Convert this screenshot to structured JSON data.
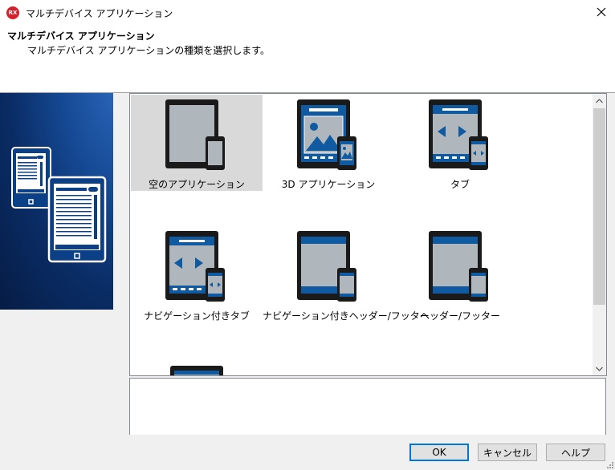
{
  "window": {
    "title": "マルチデバイス アプリケーション",
    "app_icon_text": "RX"
  },
  "header": {
    "title": "マルチデバイス アプリケーション",
    "description": "マルチデバイス アプリケーションの種類を選択します。"
  },
  "gallery": {
    "items": [
      {
        "label": "空のアプリケーション",
        "icon": "blank-app-icon",
        "selected": true
      },
      {
        "label": "3D アプリケーション",
        "icon": "3d-app-icon"
      },
      {
        "label": "タブ",
        "icon": "tab-app-icon"
      },
      {
        "label": "ナビゲーション付きタブ",
        "icon": "tab-navigation-app-icon"
      },
      {
        "label": "ナビゲーション付きヘッダー/フッター",
        "icon": "header-footer-navigation-app-icon"
      },
      {
        "label": "ヘッダー/フッター",
        "icon": "header-footer-app-icon"
      }
    ],
    "partial_item_icon": "partial-item-icon"
  },
  "buttons": {
    "ok": "OK",
    "cancel": "キャンセル",
    "help": "ヘルプ"
  },
  "colors": {
    "device_frame": "#1a1a1a",
    "device_screen": "#b0b7bc",
    "accent_blue": "#0f5aa0",
    "selection": "#d9d9d9",
    "banner_dark": "#061c44"
  }
}
